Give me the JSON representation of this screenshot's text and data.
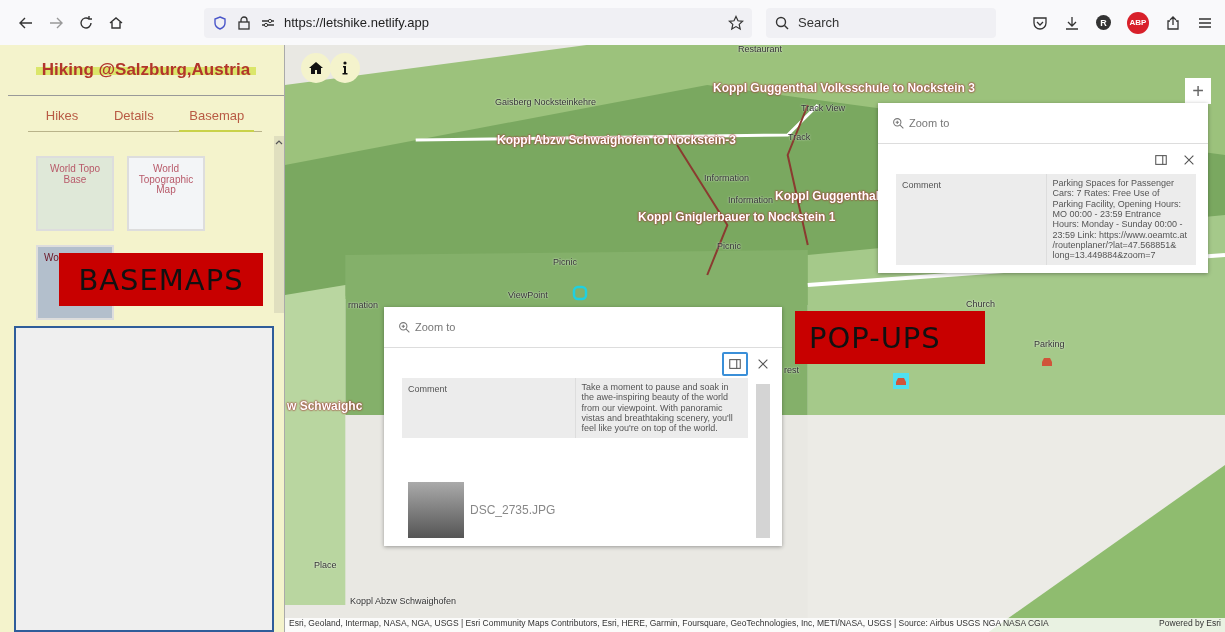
{
  "browser": {
    "url": "https://letshike.netlify.app",
    "search_placeholder": "Search",
    "avatar_letter": "R",
    "adblock_label": "ABP"
  },
  "sidebar": {
    "title": "Hiking @Salzburg,Austria",
    "tabs": [
      {
        "label": "Hikes",
        "selected": false
      },
      {
        "label": "Details",
        "selected": false
      },
      {
        "label": "Basemap",
        "selected": true
      }
    ],
    "basemaps": [
      {
        "label": "World Topo Base",
        "kind": "topo"
      },
      {
        "label": "World Topographic Map",
        "kind": "street"
      },
      {
        "label": "Wo",
        "kind": "imagery"
      }
    ],
    "banner": "BASEMAPS"
  },
  "map": {
    "labels": [
      {
        "text": "Restaurant",
        "kind": "poi"
      },
      {
        "text": "Koppl Guggenthal Volksschule to Nockstein 3",
        "kind": "trail"
      },
      {
        "text": "Gaisberg Nocksteinkehre",
        "kind": "poi"
      },
      {
        "text": "Track View",
        "kind": "poi"
      },
      {
        "text": "Koppl Abzw Schwaighofen to Nockstein-3",
        "kind": "trail"
      },
      {
        "text": "Track",
        "kind": "poi"
      },
      {
        "text": "Information",
        "kind": "poi"
      },
      {
        "text": "Information",
        "kind": "poi"
      },
      {
        "text": "Koppl Guggenthal",
        "kind": "trail"
      },
      {
        "text": "Koppl Gniglerbauer to Nockstein 1",
        "kind": "trail"
      },
      {
        "text": "Picnic",
        "kind": "poi"
      },
      {
        "text": "Picnic",
        "kind": "poi"
      },
      {
        "text": "ViewPoint",
        "kind": "poi"
      },
      {
        "text": "rmation",
        "kind": "poi"
      },
      {
        "text": "w Schwaighc",
        "kind": "trail"
      },
      {
        "text": "rest",
        "kind": "poi"
      },
      {
        "text": "Church",
        "kind": "poi"
      },
      {
        "text": "Parking",
        "kind": "poi"
      },
      {
        "text": "Place",
        "kind": "poi"
      },
      {
        "text": "Koppl Abzw Schwaighofen",
        "kind": "poi"
      }
    ],
    "zoom_in": "+",
    "attribution": "Esri, Geoland, Intermap, NASA, NGA, USGS | Esri Community Maps Contributors, Esri, HERE, Garmin, Foursquare, GeoTechnologies, Inc, METI/NASA, USGS | Source: Airbus USGS NGA NASA CGIA",
    "powered_by": "Powered by Esri"
  },
  "popups": [
    {
      "zoom_label": "Zoom to",
      "field": "Comment",
      "value": "Parking Spaces for Passenger Cars: 7 Rates: Free Use of Parking Facility, Opening Hours: MO 00:00 - 23:59 Entrance Hours: Monday - Sunday 00:00 - 23:59 Link: https://www.oeamtc.at /routenplaner/?lat=47.568851& long=13.449884&zoom=7",
      "dock_focused": false
    },
    {
      "zoom_label": "Zoom to",
      "field": "Comment",
      "value": "Take a moment to pause and soak in the awe-inspiring beauty of the world from our viewpoint. With panoramic vistas and breathtaking scenery, you'll feel like you're on top of the world.",
      "dock_focused": true,
      "attachment": "DSC_2735.JPG"
    }
  ],
  "popups_banner": "POP-UPS"
}
